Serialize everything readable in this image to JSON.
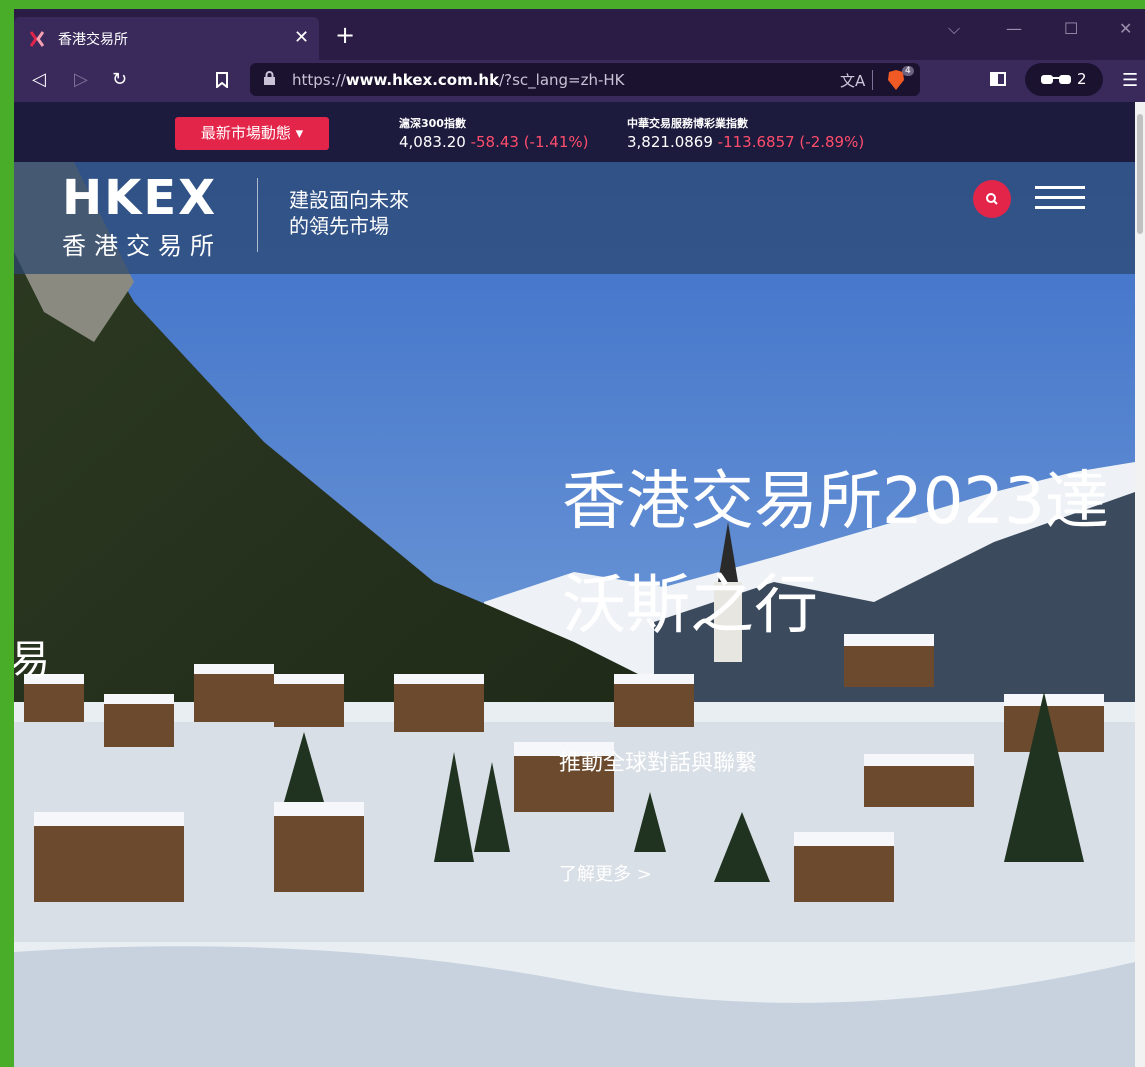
{
  "browser": {
    "tab_title": "香港交易所",
    "url_prefix": "https://",
    "url_domain": "www.hkex.com.hk",
    "url_path": "/?sc_lang=zh-HK",
    "shield_count": "4",
    "vpn_count": "2"
  },
  "ticker": {
    "market_button": "最新市場動態",
    "items": [
      {
        "name": "滬深300指數",
        "value": "4,083.20",
        "change": "-58.43 (-1.41%)"
      },
      {
        "name": "中華交易服務博彩業指數",
        "value": "3,821.0869",
        "change": "-113.6857 (-2.89%)"
      }
    ]
  },
  "header": {
    "logo": "HKEX",
    "logo_cn": "香港交易所",
    "tagline": "建設面向未來\n的領先市場"
  },
  "hero": {
    "headline_line1": "香港交易所2023達",
    "headline_line2": "沃斯之行",
    "subline": "推動全球對話與聯繫",
    "learn_more": "了解更多 >",
    "side_char": "易"
  },
  "colors": {
    "accent": "#e4254a",
    "ticker_bg": "#1c1a3d",
    "negative": "#ff4d6b"
  }
}
